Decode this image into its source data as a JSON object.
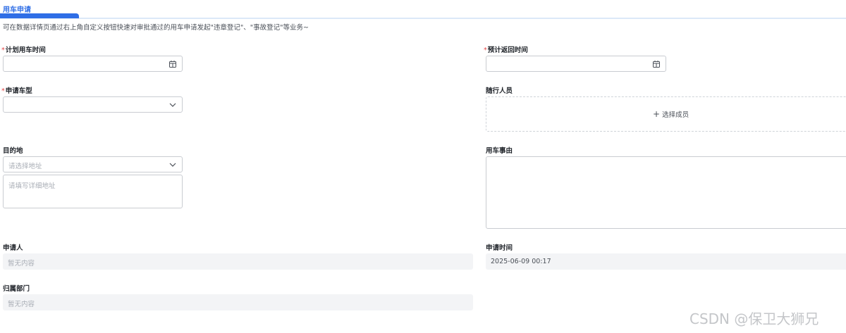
{
  "tab": {
    "label": "用车申请"
  },
  "description": "可在数据详情页通过右上角自定义按钮快速对审批通过的用车申请发起\"违章登记\"、\"事故登记\"等业务~",
  "fields": {
    "planned_time": {
      "required_mark": "*",
      "label": "计划用车时间",
      "value": ""
    },
    "return_time": {
      "required_mark": "*",
      "label": "预计返回时间",
      "value": ""
    },
    "vehicle_type": {
      "required_mark": "*",
      "label": "申请车型",
      "value": ""
    },
    "companions": {
      "label": "随行人员",
      "button_label": "选择成员"
    },
    "destination": {
      "label": "目的地",
      "select_placeholder": "请选择地址",
      "detail_placeholder": "请填写详细地址"
    },
    "reason": {
      "label": "用车事由",
      "value": ""
    },
    "applicant": {
      "label": "申请人",
      "value": "暂无内容"
    },
    "apply_time": {
      "label": "申请时间",
      "value": "2025-06-09 00:17"
    },
    "department": {
      "label": "归属部门",
      "value": "暂无内容"
    }
  },
  "watermark": "CSDN @保卫大狮兄",
  "colors": {
    "accent": "#2f6ee6",
    "required": "#e54545"
  }
}
